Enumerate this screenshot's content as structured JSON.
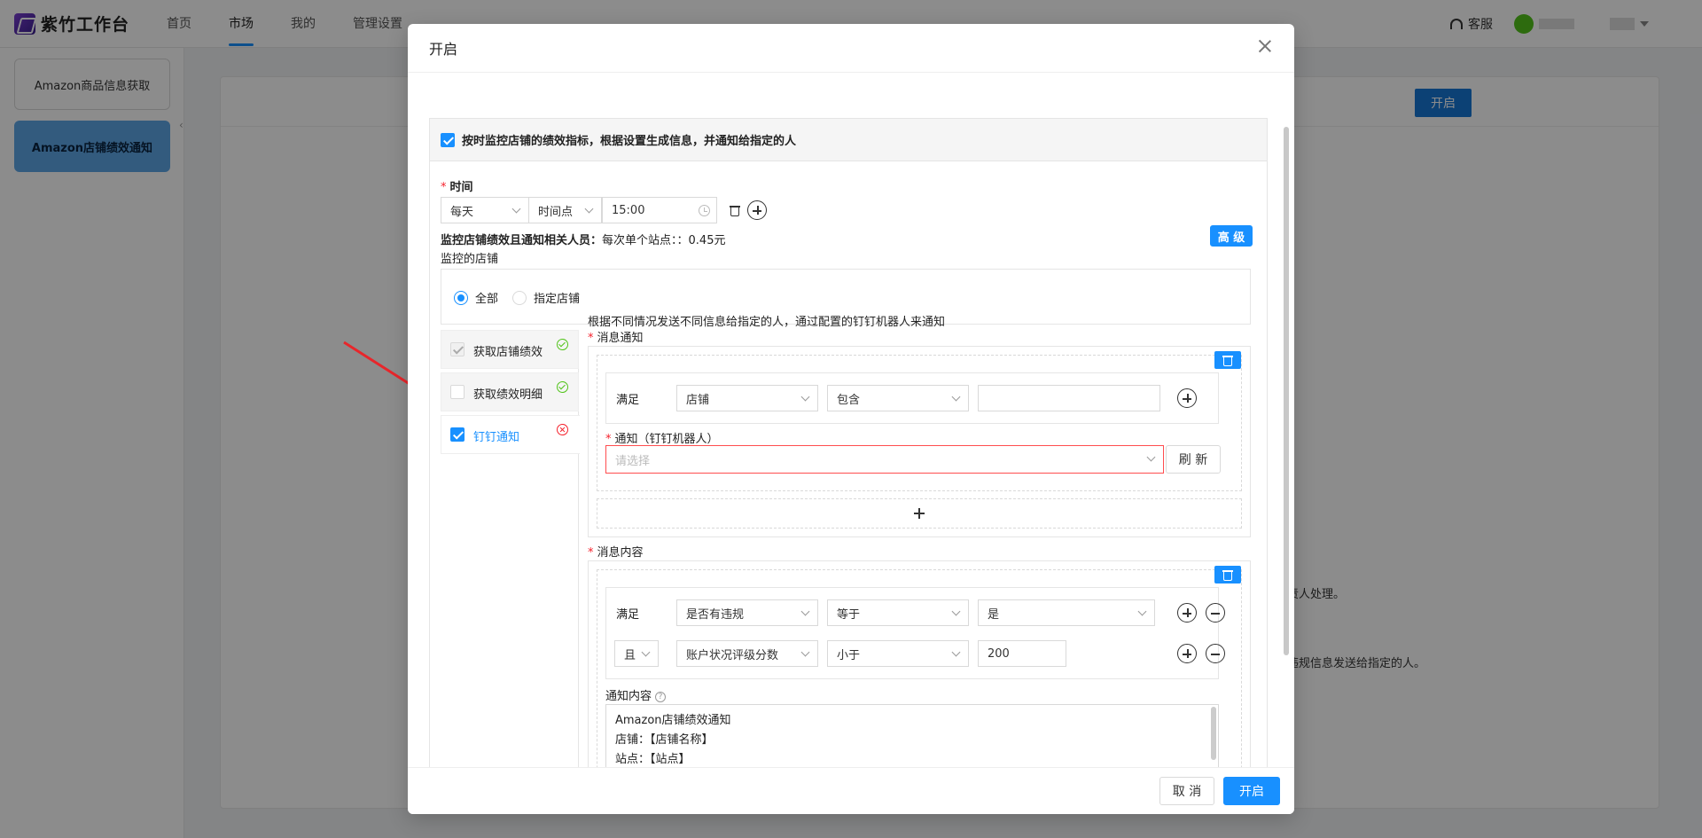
{
  "app": {
    "brand": "紫竹工作台",
    "nav": [
      "首页",
      "市场",
      "我的",
      "管理设置"
    ],
    "nav_active": "市场",
    "service_label": "客服"
  },
  "sidebar": {
    "items": [
      {
        "label": "Amazon商品信息获取"
      },
      {
        "label": "Amazon店铺绩效通知"
      }
    ]
  },
  "background": {
    "open_label": "开启",
    "text1": "责人处理。",
    "text2": "违规信息发送给指定的人。"
  },
  "modal": {
    "title": "开启",
    "enable_checkbox_label": "按时监控店铺的绩效指标，根据设置生成信息，并通知给指定的人",
    "time": {
      "label": "时间",
      "frequency": "每天",
      "mode": "时间点",
      "value": "15:00"
    },
    "cost_label": "监控店铺绩效且通知相关人员：",
    "cost_value": "每次单个站点：：0.45元",
    "advanced_label": "高 级",
    "stores_label": "监控的店铺",
    "store_options": [
      "全部",
      "指定店铺"
    ],
    "store_selected": "全部",
    "steps": [
      {
        "label": "获取店铺绩效",
        "status": "ok",
        "checked": "disabled"
      },
      {
        "label": "获取绩效明细",
        "status": "ok",
        "checked": "off"
      },
      {
        "label": "钉钉通知",
        "status": "error",
        "checked": "on"
      }
    ],
    "description": "根据不同情况发送不同信息给指定的人，通过配置的钉钉机器人来通知",
    "message_notify": {
      "label": "消息通知",
      "satisfy": "满足",
      "field": "店铺",
      "operator": "包含",
      "value": "",
      "robot_label": "通知（钉钉机器人）",
      "robot_placeholder": "请选择",
      "refresh_label": "刷 新"
    },
    "message_content": {
      "label": "消息内容",
      "rows": [
        {
          "logic": "满足",
          "field": "是否有违规",
          "operator": "等于",
          "value": "是"
        },
        {
          "logic": "且",
          "field": "账户状况评级分数",
          "operator": "小于",
          "value": "200"
        }
      ],
      "content_label": "通知内容",
      "content_lines": [
        "Amazon店铺绩效通知",
        "店铺：【店铺名称】",
        "站点：【站点】"
      ]
    },
    "cancel_label": "取 消",
    "ok_label": "开启"
  },
  "colors": {
    "primary": "#1890ff",
    "success": "#52c41a",
    "error": "#f5222d"
  }
}
